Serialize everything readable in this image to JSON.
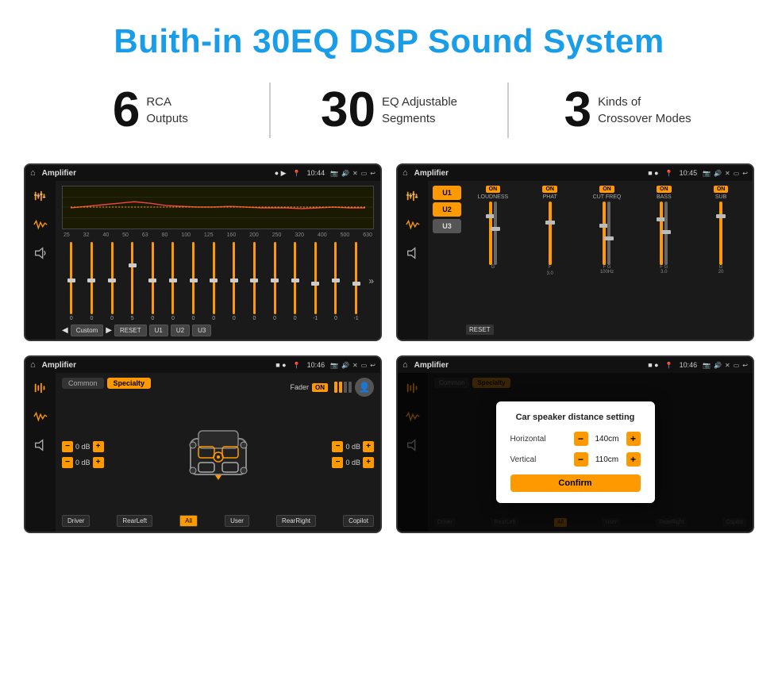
{
  "page": {
    "title": "Buith-in 30EQ DSP Sound System"
  },
  "stats": [
    {
      "number": "6",
      "label_line1": "RCA",
      "label_line2": "Outputs"
    },
    {
      "number": "30",
      "label_line1": "EQ Adjustable",
      "label_line2": "Segments"
    },
    {
      "number": "3",
      "label_line1": "Kinds of",
      "label_line2": "Crossover Modes"
    }
  ],
  "screens": [
    {
      "id": "screen1",
      "status_bar": {
        "app_title": "Amplifier",
        "time": "10:44",
        "dots": "● ▶"
      },
      "type": "eq",
      "eq_labels": [
        "25",
        "32",
        "40",
        "50",
        "63",
        "80",
        "100",
        "125",
        "160",
        "200",
        "250",
        "320",
        "400",
        "500",
        "630"
      ],
      "eq_values": [
        "0",
        "0",
        "0",
        "5",
        "0",
        "0",
        "0",
        "0",
        "0",
        "0",
        "0",
        "0",
        "-1",
        "0",
        "-1"
      ],
      "eq_buttons": [
        "Custom",
        "RESET",
        "U1",
        "U2",
        "U3"
      ]
    },
    {
      "id": "screen2",
      "status_bar": {
        "app_title": "Amplifier",
        "time": "10:45",
        "dots": "■ ●"
      },
      "type": "crossover",
      "u_buttons": [
        "U1",
        "U2",
        "U3"
      ],
      "channels": [
        {
          "label": "LOUDNESS",
          "on": true
        },
        {
          "label": "PHAT",
          "on": true
        },
        {
          "label": "CUT FREQ",
          "on": true
        },
        {
          "label": "BASS",
          "on": true
        },
        {
          "label": "SUB",
          "on": true
        }
      ],
      "reset_label": "RESET"
    },
    {
      "id": "screen3",
      "status_bar": {
        "app_title": "Amplifier",
        "time": "10:46",
        "dots": "■ ●"
      },
      "type": "speaker",
      "tabs": [
        "Common",
        "Specialty"
      ],
      "active_tab": 1,
      "fader_label": "Fader",
      "fader_on_label": "ON",
      "speaker_values": {
        "front_left": "0 dB",
        "front_right": "0 dB",
        "rear_left": "0 dB",
        "rear_right": "0 dB"
      },
      "bottom_buttons": [
        "Driver",
        "RearLeft",
        "All",
        "User",
        "RearRight",
        "Copilot"
      ]
    },
    {
      "id": "screen4",
      "status_bar": {
        "app_title": "Amplifier",
        "time": "10:46",
        "dots": "■ ●"
      },
      "type": "speaker_dialog",
      "tabs": [
        "Common",
        "Specialty"
      ],
      "active_tab": 1,
      "dialog": {
        "title": "Car speaker distance setting",
        "horizontal_label": "Horizontal",
        "horizontal_value": "140cm",
        "vertical_label": "Vertical",
        "vertical_value": "110cm",
        "confirm_label": "Confirm"
      },
      "bottom_buttons": [
        "Driver",
        "RearLeft",
        "All",
        "User",
        "RearRight",
        "Copilot"
      ]
    }
  ]
}
